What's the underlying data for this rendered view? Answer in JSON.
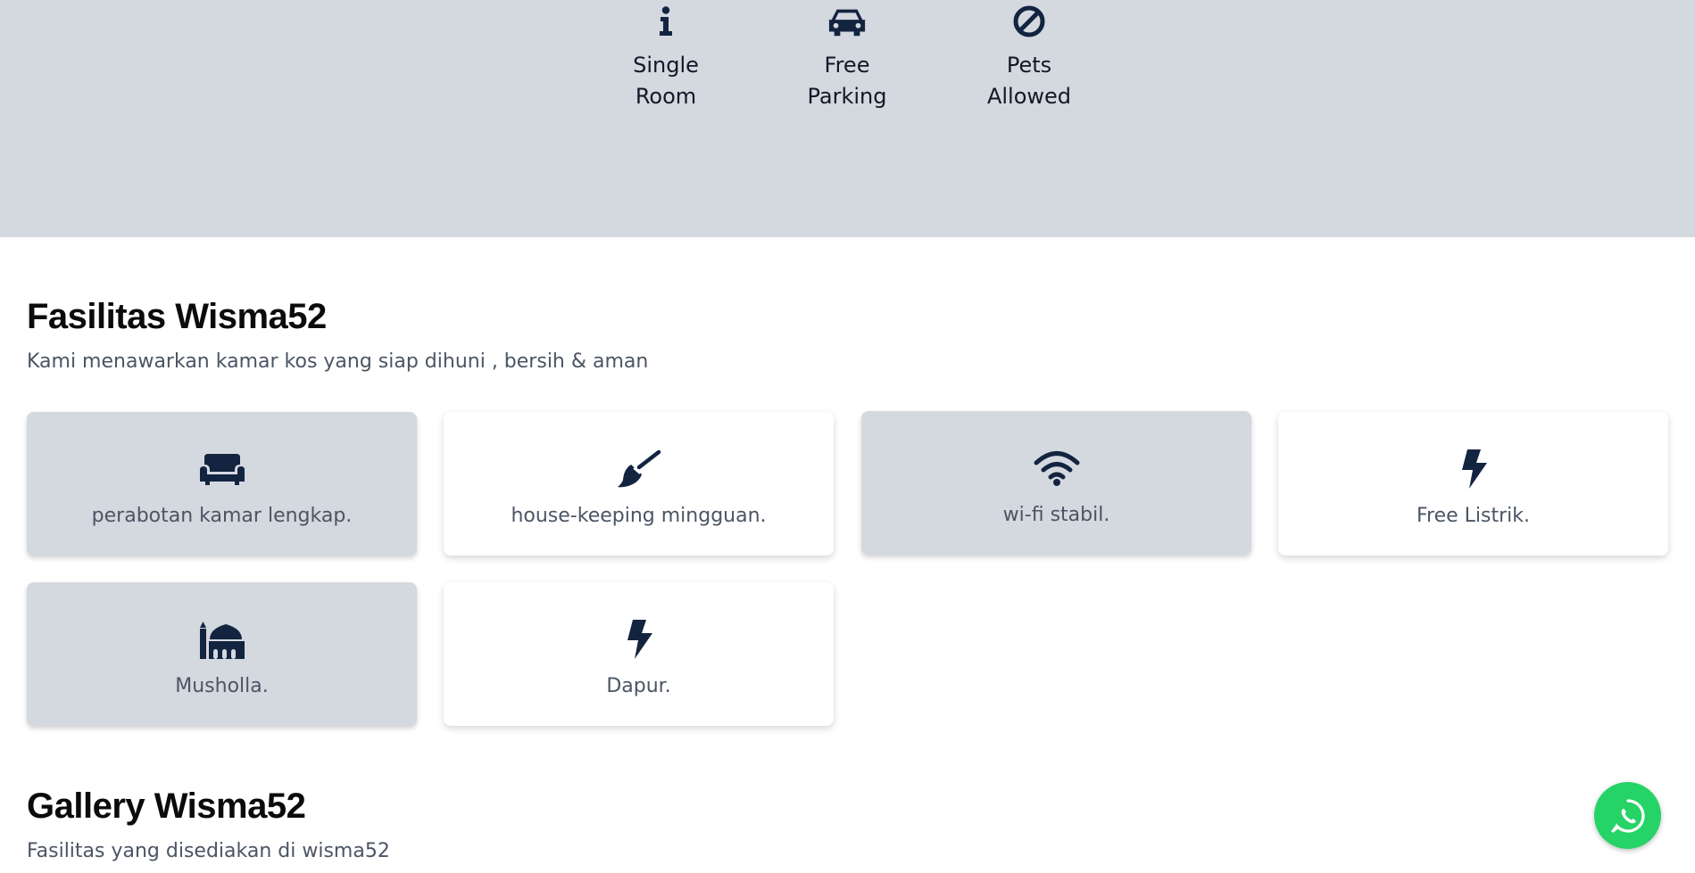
{
  "features": [
    {
      "label": "Single Room",
      "icon": "info-icon"
    },
    {
      "label": "Free Parking",
      "icon": "car-icon"
    },
    {
      "label": "Pets Allowed",
      "icon": "ban-icon"
    }
  ],
  "facilities": {
    "title": "Fasilitas Wisma52",
    "subtitle": "Kami menawarkan kamar kos yang siap dihuni , bersih & aman",
    "items": [
      {
        "label": "perabotan kamar lengkap.",
        "icon": "couch-icon"
      },
      {
        "label": "house-keeping mingguan.",
        "icon": "broom-icon"
      },
      {
        "label": "wi-fi stabil.",
        "icon": "wifi-icon"
      },
      {
        "label": "Free Listrik.",
        "icon": "bolt-icon"
      },
      {
        "label": "Musholla.",
        "icon": "mosque-icon"
      },
      {
        "label": "Dapur.",
        "icon": "bolt-icon"
      }
    ]
  },
  "gallery": {
    "title": "Gallery Wisma52",
    "subtitle": "Fasilitas yang disediakan di wisma52"
  },
  "colors": {
    "hero_bg": "#d4d8df",
    "icon": "#132440",
    "whatsapp": "#25d366"
  }
}
